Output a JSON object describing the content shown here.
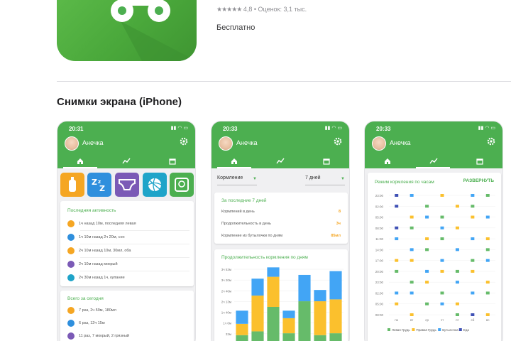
{
  "app": {
    "rating_stars": "★★★★★",
    "rating_text": "4,8 • Оценок: 3,1 тыс.",
    "price": "Бесплатно"
  },
  "screenshots_section": {
    "title": "Снимки экрана (iPhone)"
  },
  "shots": [
    {
      "status_time": "20:31",
      "status_icons": "▮▮ ◠ ▭",
      "child_name": "Анечка",
      "tiles": [
        {
          "name": "bottle-icon",
          "color": "#f5a623"
        },
        {
          "name": "sleep-icon",
          "color": "#2f8fdd"
        },
        {
          "name": "diaper-icon",
          "color": "#7b5ab6"
        },
        {
          "name": "ball-icon",
          "color": "#1fa4c9"
        },
        {
          "name": "scale-icon",
          "color": "#4caf50"
        }
      ],
      "activity": {
        "title": "Последняя активность",
        "rows": [
          {
            "text": "1ч назад 10м, последняя левая",
            "color": "#f5a623"
          },
          {
            "text": "1ч 10м назад 2ч 20м, сон",
            "color": "#2f8fdd"
          },
          {
            "text": "2ч 10м назад 10м, 30мл, оба",
            "color": "#f5a623"
          },
          {
            "text": "2ч 10м назад мокрый",
            "color": "#7b5ab6"
          },
          {
            "text": "2ч 30м назад 1ч, купание",
            "color": "#1fa4c9"
          }
        ]
      },
      "today": {
        "title": "Всего за сегодня",
        "rows": [
          {
            "text": "7 раз, 2ч 59м, 180мл",
            "color": "#f5a623"
          },
          {
            "text": "6 раз, 12ч 15м",
            "color": "#2f8fdd"
          },
          {
            "text": "11 раз, 7 мокрый, 2 грязный",
            "color": "#7b5ab6"
          }
        ]
      }
    },
    {
      "status_time": "20:33",
      "status_icons": "▮▮ ◠ ▭",
      "child_name": "Анечка",
      "filter_left": "Кормление",
      "filter_right": "7 дней",
      "summary": {
        "title": "За последние 7 дней",
        "rows": [
          {
            "label": "Кормлений в день",
            "value": "8"
          },
          {
            "label": "Продолжительность в день",
            "value": "3ч"
          },
          {
            "label": "Кормление из бутылочки по дням",
            "value": "85мл"
          }
        ]
      },
      "chart_card_title": "Продолжительность кормления по дням"
    },
    {
      "status_time": "20:33",
      "status_icons": "▮▮ ◠ ▭",
      "child_name": "Анечка",
      "chart_title": "Режим кормления по часам",
      "expand_label": "РАЗВЕРНУТЬ"
    }
  ],
  "chart_data": [
    {
      "type": "bar",
      "title": "Продолжительность кормления по дням",
      "stacked": true,
      "y_tick_labels": [
        "3ч 53м",
        "3ч 20м",
        "2ч 46м",
        "2ч 13м",
        "1ч 40м",
        "1ч 6м",
        "33м",
        "0м"
      ],
      "categories": [
        "1",
        "2",
        "3",
        "4",
        "5",
        "6",
        "7"
      ],
      "series": [
        {
          "color": "#66bb6a",
          "values": [
            0.5,
            0.7,
            2.0,
            0.6,
            2.3,
            0.5,
            0.6
          ]
        },
        {
          "color": "#fbc02d",
          "values": [
            0.6,
            1.9,
            1.6,
            0.8,
            0.0,
            1.8,
            1.8
          ]
        },
        {
          "color": "#42a5f5",
          "values": [
            0.7,
            0.9,
            0.5,
            0.4,
            1.4,
            0.6,
            1.5
          ]
        }
      ],
      "ylim": [
        0,
        4
      ]
    },
    {
      "type": "scatter",
      "title": "Режим кормления по часам",
      "y_tick_labels": [
        "23:00",
        "02:00",
        "05:00",
        "08:00",
        "11:00",
        "14:00",
        "17:00",
        "20:00",
        "23:00",
        "02:00",
        "05:00",
        "08:00"
      ],
      "x_tick_labels": [
        "пн",
        "вт",
        "ср",
        "чт",
        "пт",
        "сб",
        "вс"
      ],
      "legend": [
        {
          "label": "Левая Грудь",
          "color": "#66bb6a"
        },
        {
          "label": "Правая Грудь",
          "color": "#fbc02d"
        },
        {
          "label": "Бутылочка",
          "color": "#42a5f5"
        },
        {
          "label": "Еда",
          "color": "#3f51b5"
        }
      ],
      "points": [
        {
          "day": 0,
          "slot": 0,
          "s": 3
        },
        {
          "day": 1,
          "slot": 0,
          "s": 2
        },
        {
          "day": 3,
          "slot": 0,
          "s": 1
        },
        {
          "day": 5,
          "slot": 0,
          "s": 2
        },
        {
          "day": 6,
          "slot": 0,
          "s": 0
        },
        {
          "day": 0,
          "slot": 1,
          "s": 3
        },
        {
          "day": 2,
          "slot": 1,
          "s": 0
        },
        {
          "day": 4,
          "slot": 1,
          "s": 1
        },
        {
          "day": 5,
          "slot": 1,
          "s": 0
        },
        {
          "day": 1,
          "slot": 2,
          "s": 1
        },
        {
          "day": 2,
          "slot": 2,
          "s": 2
        },
        {
          "day": 3,
          "slot": 2,
          "s": 0
        },
        {
          "day": 5,
          "slot": 2,
          "s": 1
        },
        {
          "day": 6,
          "slot": 2,
          "s": 2
        },
        {
          "day": 0,
          "slot": 3,
          "s": 3
        },
        {
          "day": 1,
          "slot": 3,
          "s": 0
        },
        {
          "day": 3,
          "slot": 3,
          "s": 2
        },
        {
          "day": 4,
          "slot": 3,
          "s": 1
        },
        {
          "day": 0,
          "slot": 4,
          "s": 2
        },
        {
          "day": 2,
          "slot": 4,
          "s": 1
        },
        {
          "day": 3,
          "slot": 4,
          "s": 0
        },
        {
          "day": 5,
          "slot": 4,
          "s": 2
        },
        {
          "day": 6,
          "slot": 4,
          "s": 1
        },
        {
          "day": 1,
          "slot": 5,
          "s": 2
        },
        {
          "day": 2,
          "slot": 5,
          "s": 0
        },
        {
          "day": 4,
          "slot": 5,
          "s": 2
        },
        {
          "day": 6,
          "slot": 5,
          "s": 0
        },
        {
          "day": 0,
          "slot": 6,
          "s": 1
        },
        {
          "day": 1,
          "slot": 6,
          "s": 1
        },
        {
          "day": 3,
          "slot": 6,
          "s": 2
        },
        {
          "day": 5,
          "slot": 6,
          "s": 0
        },
        {
          "day": 6,
          "slot": 6,
          "s": 2
        },
        {
          "day": 0,
          "slot": 7,
          "s": 0
        },
        {
          "day": 2,
          "slot": 7,
          "s": 2
        },
        {
          "day": 3,
          "slot": 7,
          "s": 1
        },
        {
          "day": 4,
          "slot": 7,
          "s": 0
        },
        {
          "day": 5,
          "slot": 7,
          "s": 1
        },
        {
          "day": 1,
          "slot": 8,
          "s": 0
        },
        {
          "day": 2,
          "slot": 8,
          "s": 1
        },
        {
          "day": 4,
          "slot": 8,
          "s": 2
        },
        {
          "day": 6,
          "slot": 8,
          "s": 1
        },
        {
          "day": 0,
          "slot": 9,
          "s": 2
        },
        {
          "day": 1,
          "slot": 9,
          "s": 2
        },
        {
          "day": 3,
          "slot": 9,
          "s": 0
        },
        {
          "day": 5,
          "slot": 9,
          "s": 2
        },
        {
          "day": 6,
          "slot": 9,
          "s": 0
        },
        {
          "day": 0,
          "slot": 10,
          "s": 1
        },
        {
          "day": 2,
          "slot": 10,
          "s": 0
        },
        {
          "day": 3,
          "slot": 10,
          "s": 2
        },
        {
          "day": 4,
          "slot": 10,
          "s": 1
        },
        {
          "day": 1,
          "slot": 11,
          "s": 1
        },
        {
          "day": 4,
          "slot": 11,
          "s": 0
        },
        {
          "day": 5,
          "slot": 11,
          "s": 3
        },
        {
          "day": 6,
          "slot": 11,
          "s": 1
        }
      ]
    }
  ]
}
